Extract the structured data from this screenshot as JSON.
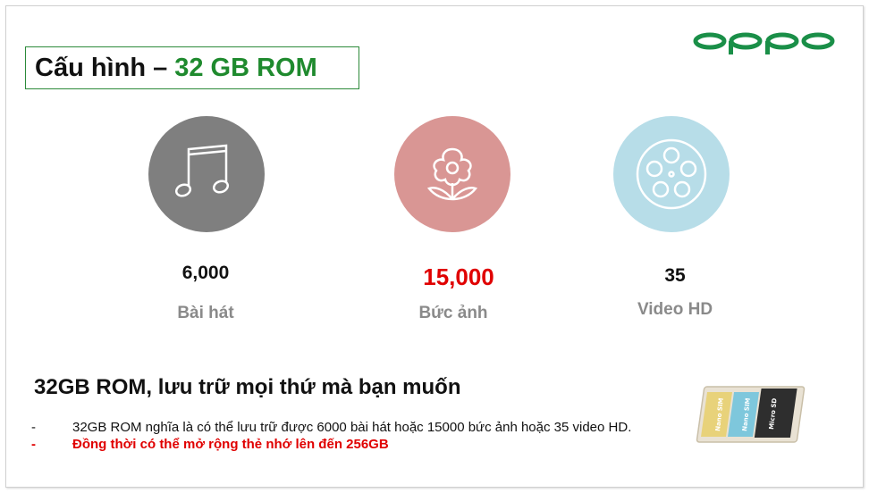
{
  "title": {
    "prefix": "Cấu hình –",
    "highlight": "32 GB ROM"
  },
  "logo": {
    "text": "oppo",
    "color": "#1a8f48"
  },
  "stats": [
    {
      "value": "6,000",
      "label": "Bài hát",
      "icon": "music-note-icon",
      "circle_color": "#7f7f7f"
    },
    {
      "value": "15,000",
      "label": "Bức ảnh",
      "icon": "flower-icon",
      "circle_color": "#d99694"
    },
    {
      "value": "35",
      "label": "Video HD",
      "icon": "film-reel-icon",
      "circle_color": "#b7dde8"
    }
  ],
  "subheading": "32GB ROM, lưu trữ mọi thứ mà bạn muốn",
  "bullets": [
    {
      "marker": "-",
      "text": "32GB ROM nghĩa là có thể lưu trữ được 6000 bài hát hoặc 15000 bức ảnh hoặc 35 video HD."
    },
    {
      "marker": "-",
      "text": "Đồng thời có thể mở rộng thẻ nhớ lên đến 256GB"
    }
  ],
  "sim_tray": {
    "labels": [
      "Nano SIM",
      "Nano SIM",
      "Micro SD"
    ]
  },
  "colors": {
    "green": "#1f8a2e",
    "red": "#e00000"
  }
}
